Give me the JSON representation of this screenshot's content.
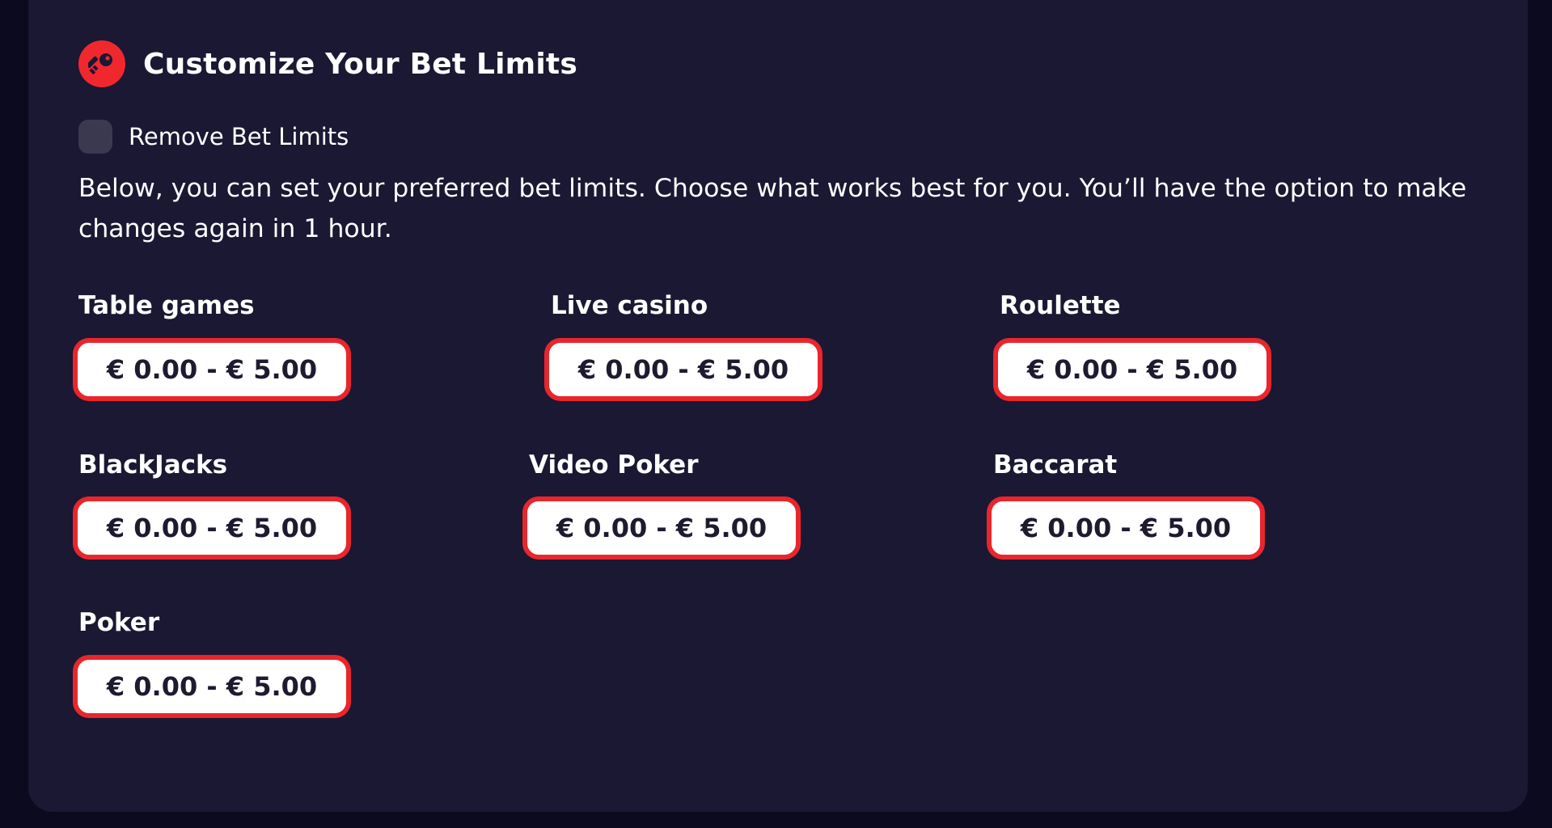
{
  "header": {
    "title": "Customize Your Bet Limits",
    "icon": "key-icon",
    "accent_color": "#f0282e"
  },
  "remove_limits": {
    "label": "Remove Bet Limits",
    "checked": false
  },
  "description": "Below, you can set your preferred bet limits. Choose what works best for you. You’ll have the option to make changes again in 1 hour.",
  "games": [
    {
      "label": "Table games",
      "range": "€ 0.00 - € 5.00"
    },
    {
      "label": "Live casino",
      "range": "€ 0.00 - € 5.00"
    },
    {
      "label": "Roulette",
      "range": "€ 0.00 - € 5.00"
    },
    {
      "label": "BlackJacks",
      "range": "€ 0.00 - € 5.00"
    },
    {
      "label": "Video Poker",
      "range": "€ 0.00 - € 5.00"
    },
    {
      "label": "Baccarat",
      "range": "€ 0.00 - € 5.00"
    },
    {
      "label": "Poker",
      "range": "€ 0.00 - € 5.00"
    }
  ]
}
